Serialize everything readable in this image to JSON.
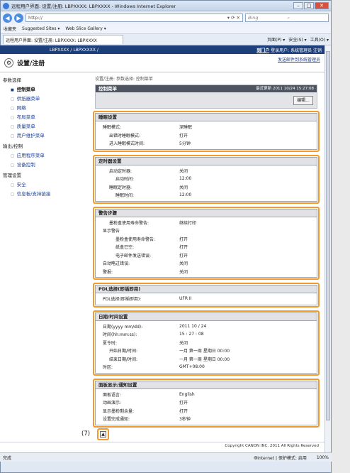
{
  "window": {
    "title": "远程用户界面: 设置/注册: LBPXXXX: LBPXXXX - Windows Internet Explorer",
    "url": "http://",
    "search_placeholder": "Bing"
  },
  "favorites": {
    "label": "收藏夹",
    "suggested": "Suggested Sites ▾",
    "gallery": "Web Slice Gallery ▾"
  },
  "tab": {
    "label": "远程用户界面: 设置/注册: LBPXXXX: LBPXXXX"
  },
  "tools": [
    "页面(P) ▾",
    "安全(S) ▾",
    "工具(O) ▾"
  ],
  "header": {
    "device": "LBPXXXX / LBPXXXXX /",
    "portal": "到门户",
    "login": "登录用户: 系统管理员 注销"
  },
  "sub": {
    "title": "设置/注册",
    "admin_link": "发送邮件到系统管理员"
  },
  "sidebar": [
    {
      "h": "参数选择"
    },
    {
      "i": "控制菜单",
      "on": true
    },
    {
      "i": "供纸器菜单"
    },
    {
      "i": "网络"
    },
    {
      "i": "布局菜单"
    },
    {
      "i": "质量菜单"
    },
    {
      "i": "用户维护菜单"
    },
    {
      "h": "输出/控制"
    },
    {
      "i": "应用程序菜单"
    },
    {
      "i": "设备控制"
    },
    {
      "h": "管理设置"
    },
    {
      "i": "安全"
    },
    {
      "i": "信息板/支持链接"
    }
  ],
  "main": {
    "crumb": "设置/注册: 参数选择: 控制菜单",
    "menu_title": "控制菜单",
    "updated": "最近更新 2011 10/24 15:27:08",
    "edit": "编辑..."
  },
  "sections": [
    {
      "title": "睡眠设置",
      "num": "(1)",
      "rows": [
        [
          "睡眠模式:",
          "深睡眠",
          0
        ],
        [
          "出错时睡眠模式:",
          "打开",
          1
        ],
        [
          "进入睡眠模式时间:",
          "5分钟",
          1
        ]
      ]
    },
    {
      "title": "定时器设置",
      "num": "(2)",
      "rows": [
        [
          "启动定时器:",
          "关闭",
          1
        ],
        [
          "启动时间:",
          "12:00",
          2
        ],
        [
          "睡眠定时器:",
          "关闭",
          1
        ],
        [
          "睡眠时间:",
          "12:00",
          2
        ]
      ]
    },
    {
      "title": "警告步骤",
      "num": "(3)",
      "rows": [
        [
          "墨粉盒使用寿命警告:",
          "继续打印",
          1
        ],
        [
          "显示警告",
          null,
          0
        ],
        [
          "墨粉盒使用寿命警告:",
          "打开",
          2
        ],
        [
          "纸盒已空:",
          "打开",
          2
        ],
        [
          "电子邮件发送错误:",
          "打开",
          2
        ],
        [
          "自动略过错误:",
          "关闭",
          0
        ],
        [
          "警报:",
          "关闭",
          0
        ]
      ]
    },
    {
      "title": "PDL选择(即插即用)",
      "num": "(4)",
      "rows": [
        [
          "PDL选择(即插即用):",
          "UFR II",
          0
        ]
      ]
    },
    {
      "title": "日期/时间设置",
      "num": "(5)",
      "rows": [
        [
          "日期(yyyy mm/dd):",
          "2011 10 / 24",
          0
        ],
        [
          "时间(hh:mm:ss):",
          "15 : 27 : 08",
          0
        ],
        [
          "夏令时:",
          "关闭",
          0
        ],
        [
          "开始日期/时间:",
          "一月 第一周 星期日 00:00",
          1
        ],
        [
          "结束日期/时间:",
          "一月 第一周 星期日 00:00",
          1
        ],
        [
          "时区:",
          "GMT+08:00",
          0
        ]
      ]
    },
    {
      "title": "面板显示/通知设置",
      "num": "(6)",
      "rows": [
        [
          "面板语言:",
          "English",
          0
        ],
        [
          "动画演示:",
          "打开",
          0
        ],
        [
          "显示墨粉剩余量:",
          "打开",
          0
        ],
        [
          "设置完成通知:",
          "3秒钟",
          0
        ]
      ]
    }
  ],
  "footer": "Copyright CANON INC. 2011 All Rights Reserved",
  "top_num": "(7)",
  "status": {
    "left": "完成",
    "mode": "Internet | 保护模式: 启用",
    "zoom": "100%"
  }
}
